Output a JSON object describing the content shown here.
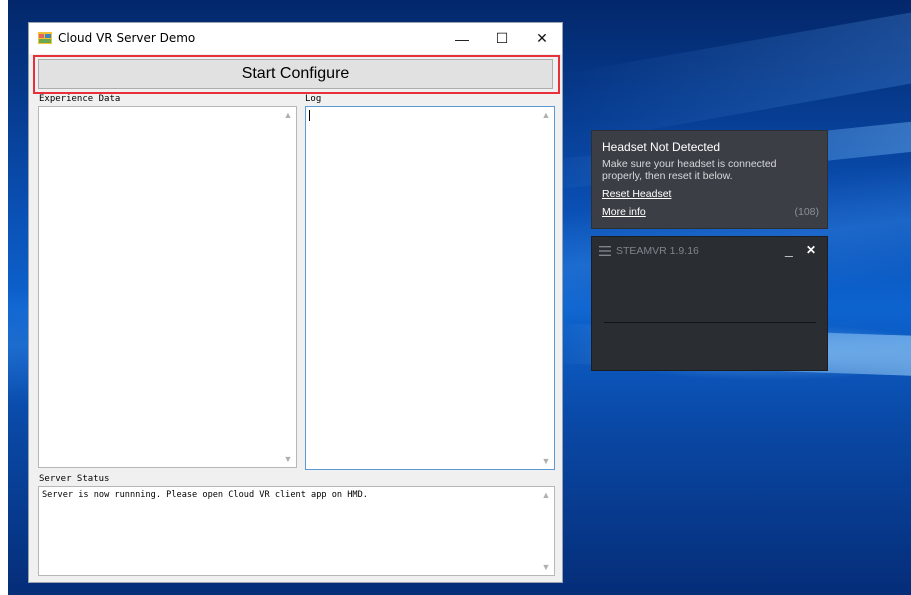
{
  "window": {
    "title": "Cloud VR Server Demo",
    "controls": {
      "minimize": "—",
      "maximize": "☐",
      "close": "✕"
    },
    "start_button_label": "Start Configure",
    "experience_label": "Experience Data",
    "log_label": "Log",
    "server_status_label": "Server Status",
    "server_status_text": "Server is now runnning. Please open Cloud VR client app on HMD."
  },
  "scroll": {
    "up": "▲",
    "down": "▼"
  },
  "notification": {
    "title": "Headset Not Detected",
    "body": "Make sure your headset is connected properly, then reset it below.",
    "reset_link": "Reset Headset",
    "more_link": "More info",
    "count": "(108)"
  },
  "steamvr": {
    "title": "STEAMVR 1.9.16",
    "minimize": "_",
    "close": "✕"
  },
  "colors": {
    "highlight": "#e8303a",
    "focus_border": "#5b9bd5",
    "notification_bg": "#3b3f45",
    "steam_bg": "#2a2d32"
  }
}
